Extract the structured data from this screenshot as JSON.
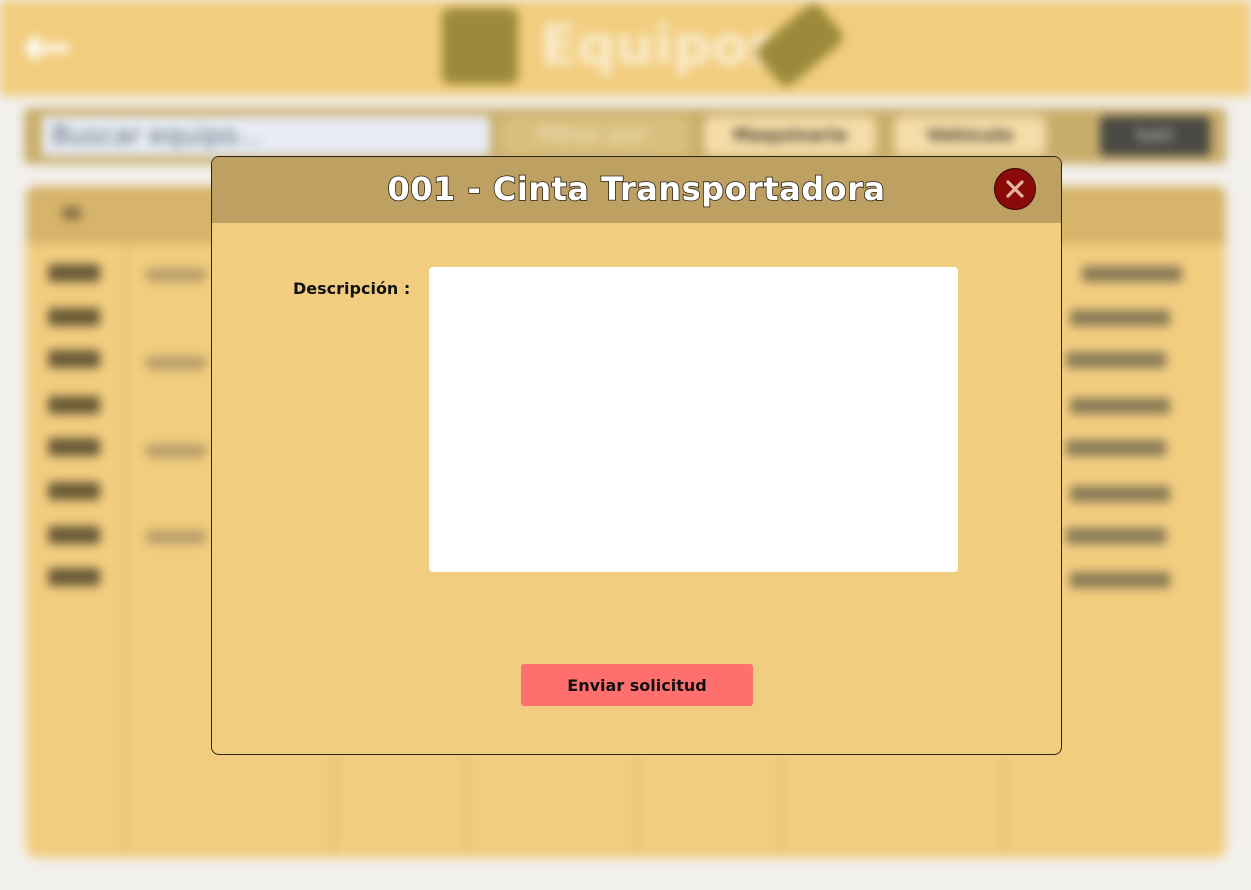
{
  "background_app": {
    "header": {
      "title": "Equipos",
      "back_icon": "arrow-left-icon",
      "title_icon_left": "folder-icon",
      "title_icon_right": "tag-icon"
    },
    "toolbar": {
      "search_placeholder": "Buscar equipo...",
      "filter_label": "Filtrar por:",
      "chip_1": "Maquinaria",
      "chip_2": "Vehículo",
      "action_label": "Salir"
    },
    "table": {
      "col_id": "ID",
      "ids": [
        "001",
        "002",
        "003",
        "004",
        "005",
        "006",
        "007",
        "008"
      ]
    }
  },
  "modal": {
    "title": "001 -  Cinta Transportadora",
    "close_icon": "close-x-icon",
    "description_label": "Descripción :",
    "description_value": "",
    "submit_label": "Enviar solicitud"
  },
  "colors": {
    "page_bg": "#f1cd7f",
    "modal_header": "#bea062",
    "close_button": "#8b0a0a",
    "submit_button": "#fe6f6e"
  }
}
